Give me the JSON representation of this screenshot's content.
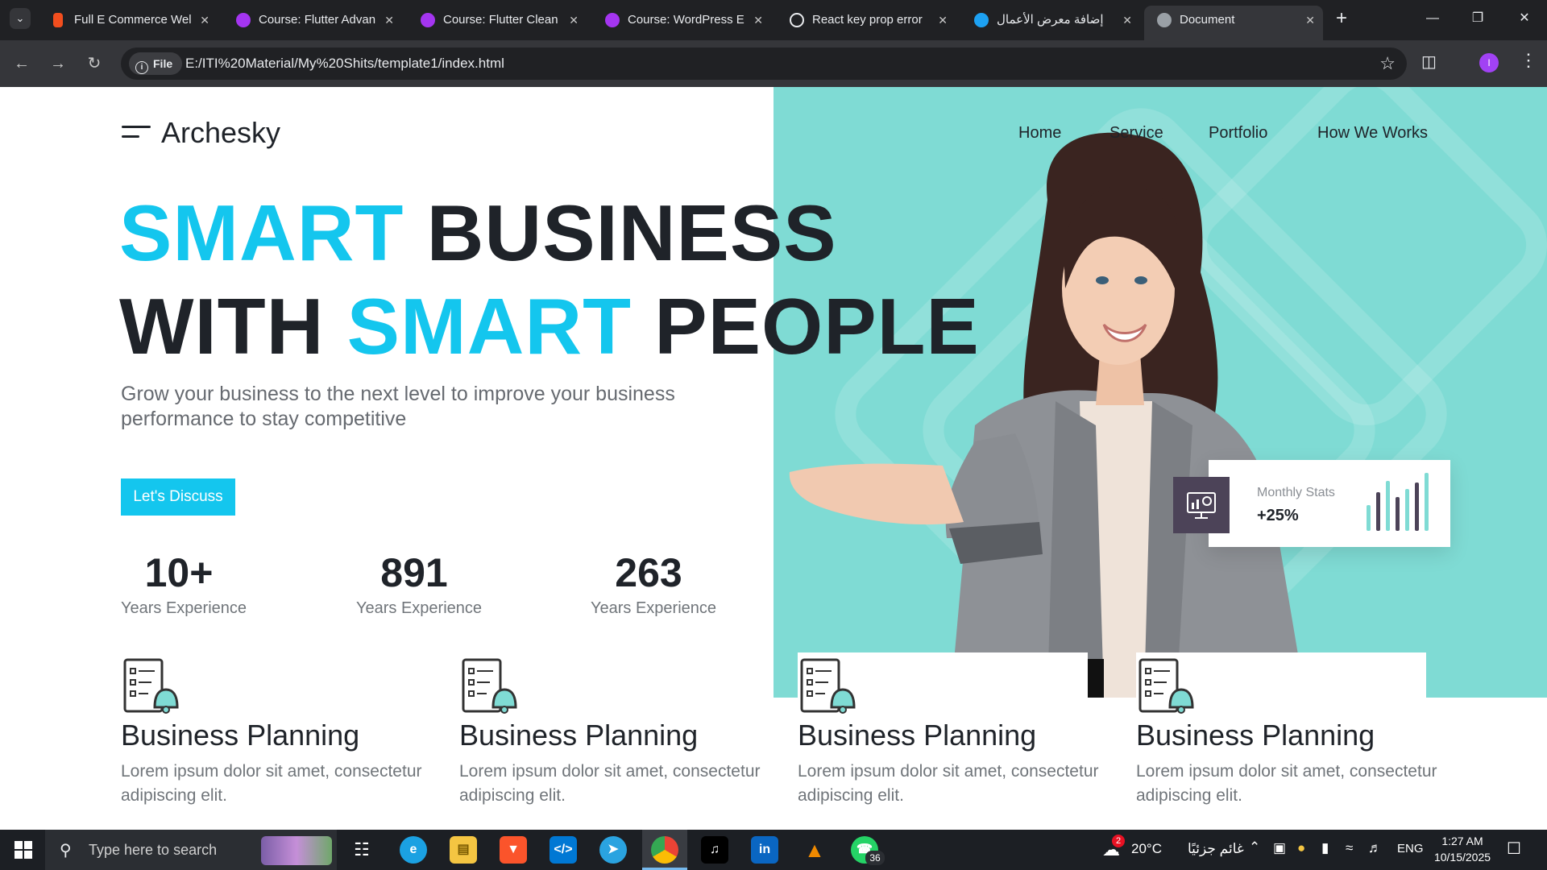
{
  "browser": {
    "tabs": [
      {
        "title": "Full E Commerce Wel",
        "icon": "figma-icon",
        "color": "#f24e1e"
      },
      {
        "title": "Course: Flutter Advan",
        "icon": "udemy-icon",
        "color": "#a435f0"
      },
      {
        "title": "Course: Flutter Clean",
        "icon": "udemy-icon",
        "color": "#a435f0"
      },
      {
        "title": "Course: WordPress E",
        "icon": "udemy-icon",
        "color": "#a435f0"
      },
      {
        "title": "React key prop error",
        "icon": "chatgpt-icon",
        "color": "#e8eaed"
      },
      {
        "title": "إضافة معرض الأعمال",
        "icon": "khamsat-icon",
        "color": "#1da1f2"
      },
      {
        "title": "Document",
        "icon": "globe-icon",
        "color": "#9aa0a6"
      }
    ],
    "active_tab": "Document",
    "url_chip": "File",
    "url": "E:/ITI%20Material/My%20Shits/template1/index.html",
    "profile_initial": "I"
  },
  "site": {
    "logo": "Archesky",
    "nav": [
      "Home",
      "Service",
      "Portfolio",
      "How We Works"
    ],
    "hero": {
      "line1_accent": "SMART",
      "line1_rest": " BUSINESS",
      "line2_start": "WITH ",
      "line2_accent": "SMART",
      "line2_end": " PEOPLE"
    },
    "subtitle": "Grow your business to the next level to improve your business performance to stay competitive",
    "cta": "Let's Discuss",
    "stats": [
      {
        "value": "10+",
        "label": "Years Experience"
      },
      {
        "value": "891",
        "label": "Years Experience"
      },
      {
        "value": "263",
        "label": "Years Experience"
      }
    ],
    "stats_card": {
      "title": "Monthly Stats",
      "value": "+25%"
    },
    "services": [
      {
        "title": "Business Planning",
        "desc": "Lorem ipsum dolor sit amet, consectetur adipiscing elit."
      },
      {
        "title": "Business Planning",
        "desc": "Lorem ipsum dolor sit amet, consectetur adipiscing elit."
      },
      {
        "title": "Business Planning",
        "desc": "Lorem ipsum dolor sit amet, consectetur adipiscing elit."
      },
      {
        "title": "Business Planning",
        "desc": "Lorem ipsum dolor sit amet, consectetur adipiscing elit."
      }
    ],
    "colors": {
      "accent": "#14c6ee",
      "panel": "#7fdbd4",
      "dark": "#1f2329"
    }
  },
  "taskbar": {
    "search_placeholder": "Type here to search",
    "whatsapp_badge": "36",
    "weather_badge": "2",
    "weather": "20°C",
    "weather_desc": "غائم جزئيًا",
    "language": "ENG",
    "time": "1:27 AM",
    "date": "10/15/2025"
  }
}
